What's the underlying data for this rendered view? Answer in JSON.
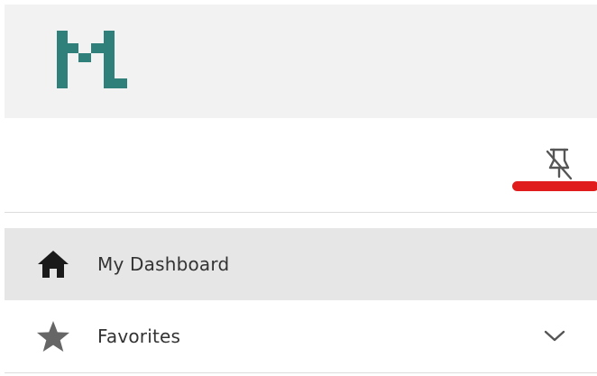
{
  "brand": {
    "logo": "mainframe-logo-icon",
    "color": "#2f7f7a"
  },
  "pin": {
    "icon": "unpin-icon",
    "highlight_color": "#e01c1c"
  },
  "nav": {
    "items": [
      {
        "label": "My Dashboard",
        "icon": "home-icon",
        "active": true
      },
      {
        "label": "Favorites",
        "icon": "star-icon",
        "expand_icon": "chevron-down-icon"
      }
    ]
  },
  "colors": {
    "header_bg": "#f2f2f2",
    "active_bg": "#e6e6e6",
    "text": "#333333"
  }
}
